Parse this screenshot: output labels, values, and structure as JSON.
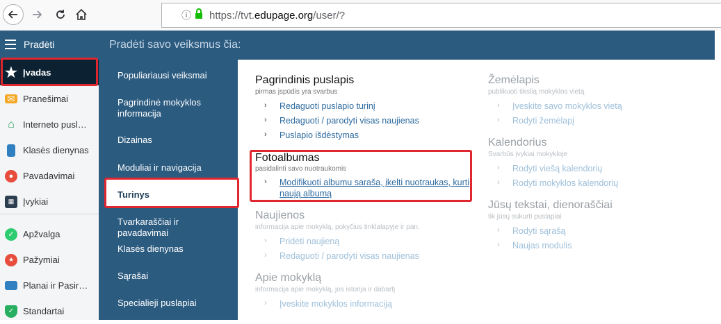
{
  "browser": {
    "url_prefix": "https://tvt.",
    "url_domain": "edupage.org",
    "url_path": "/user/?"
  },
  "topbar": {
    "menu_title": "Pradėti",
    "hint": "Pradėti savo veiksmus čia:"
  },
  "sidebar": {
    "items": [
      {
        "label": "Įvadas",
        "icon": "star-icon"
      },
      {
        "label": "Pranešimai",
        "icon": "mail-icon"
      },
      {
        "label": "Interneto pusl…",
        "icon": "home-icon"
      },
      {
        "label": "Klasės dienynas",
        "icon": "book-icon"
      },
      {
        "label": "Pavadavimai",
        "icon": "user-icon"
      },
      {
        "label": "Įvykiai",
        "icon": "calendar-icon"
      },
      {
        "label": "Apžvalga",
        "icon": "check-icon"
      },
      {
        "label": "Pažymiai",
        "icon": "grades-icon"
      },
      {
        "label": "Planai ir Pasir…",
        "icon": "briefcase-icon"
      },
      {
        "label": "Standartai",
        "icon": "shield-icon"
      }
    ]
  },
  "midmenu": {
    "items": [
      "Populiariausi veiksmai",
      "Pagrindinė mokyklos informacija",
      "Dizainas",
      "Moduliai ir navigacija",
      "Turinys",
      "Tvarkaraščiai ir pavadavimai",
      "Klasės dienynas",
      "Sąrašai",
      "Specialieji puslapiai"
    ]
  },
  "sections": {
    "pagrindinis": {
      "title": "Pagrindinis puslapis",
      "subtitle": "pirmas įspūdis yra svarbus",
      "links": [
        "Redaguoti puslapio turinį",
        "Redaguoti / parodyti visas naujienas",
        "Puslapio išdėstymas"
      ]
    },
    "fotoalbumas": {
      "title": "Fotoalbumas",
      "subtitle": "pasidalinti savo nuotraukomis",
      "links": [
        "Modifikuoti albumu sarašа, įkelti nuotraukas, kurti",
        "naują albumą"
      ]
    },
    "naujienos": {
      "title": "Naujienos",
      "subtitle": "informacija apie mokyklą, pokyčius tinklalapyje ir pan.",
      "links": [
        "Pridėti naujieną",
        "Redaguoti / parodyti visas naujienas"
      ]
    },
    "apie": {
      "title": "Apie mokyklą",
      "subtitle": "informacija apie mokyklą, jos istorija ir dabartį",
      "links": [
        "Įveskite mokyklos informaciją"
      ]
    },
    "zemelapis": {
      "title": "Žemėlapis",
      "subtitle": "publikuoti tikslią mokyklos vietą",
      "links": [
        "Įveskite savo mokyklos vietą",
        "Rodyti žemėlapį"
      ]
    },
    "kalendorius": {
      "title": "Kalendorius",
      "subtitle": "Svarbūs įvykiai mokykloje",
      "links": [
        "Rodyti viešą kalendorių",
        "Rodyti mokyklos kalendorių"
      ]
    },
    "tekstai": {
      "title": "Jūsų tekstai, dienoraščiai",
      "subtitle": "tik jūsų sukurti puslapiai",
      "links": [
        "Rodyti sąrašą",
        "Naujas modulis"
      ]
    }
  },
  "colors": {
    "primary": "#2c5b80",
    "highlight": "#e0262e",
    "link": "#2d6a9f"
  }
}
